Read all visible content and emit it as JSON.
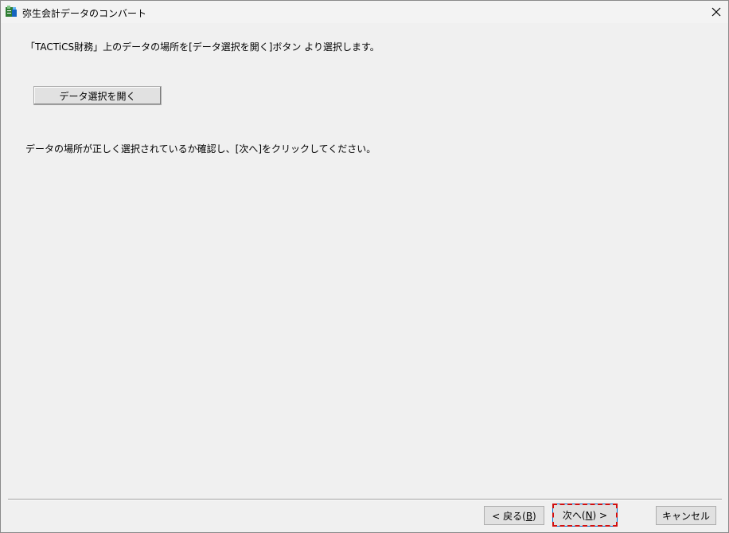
{
  "window": {
    "title": "弥生会計データのコンバート",
    "icon": "app-icon"
  },
  "content": {
    "instruction1": "「TACTiCS財務」上のデータの場所を[データ選択を開く]ボタン より選択します。",
    "open_button_label": "データ選択を開く",
    "instruction2": "データの場所が正しく選択されているか確認し、[次へ]をクリックしてください。"
  },
  "footer": {
    "back_label_prefix": "< 戻る(",
    "back_key": "B",
    "back_label_suffix": ")",
    "next_label_prefix": "次へ(",
    "next_key": "N",
    "next_label_suffix": ") >",
    "cancel_label": "キャンセル"
  },
  "colors": {
    "background": "#f0f0f0",
    "focus_outline": "#d01010",
    "default_button_border": "#0078d7"
  }
}
